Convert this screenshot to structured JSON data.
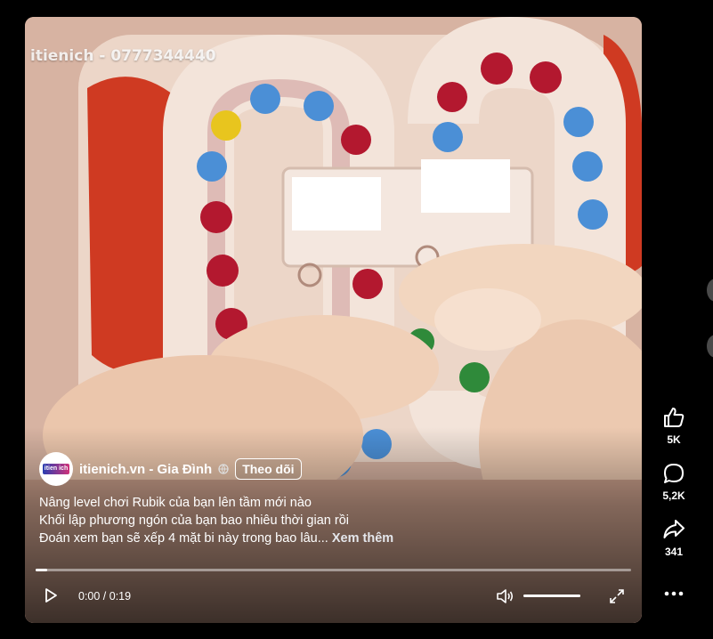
{
  "video": {
    "watermark": "itienich - 0777344440",
    "author": {
      "avatar_text": "itien ich",
      "name": "itienich.vn - Gia Đình",
      "follow_label": "Theo dõi"
    },
    "caption": {
      "line1": "Nâng level chơi Rubik của bạn lên tầm mới nào",
      "line2": "Khối lập phương ngón của bạn bao nhiêu thời gian rồi",
      "line3": "Đoán xem bạn sẽ xếp 4 mặt bi này trong bao lâu...",
      "more": "Xem thêm"
    },
    "controls": {
      "time": "0:00 / 0:19",
      "progress_fraction": 0.02,
      "volume_fraction": 1.0
    }
  },
  "side_actions": {
    "like": {
      "icon": "thumbs-up-icon",
      "count": "5K"
    },
    "comment": {
      "icon": "comment-icon",
      "count": "5,2K"
    },
    "share": {
      "icon": "share-icon",
      "count": "341"
    },
    "more": {
      "icon": "more-icon"
    }
  },
  "colors": {
    "background": "#000000",
    "text": "#ffffff"
  }
}
